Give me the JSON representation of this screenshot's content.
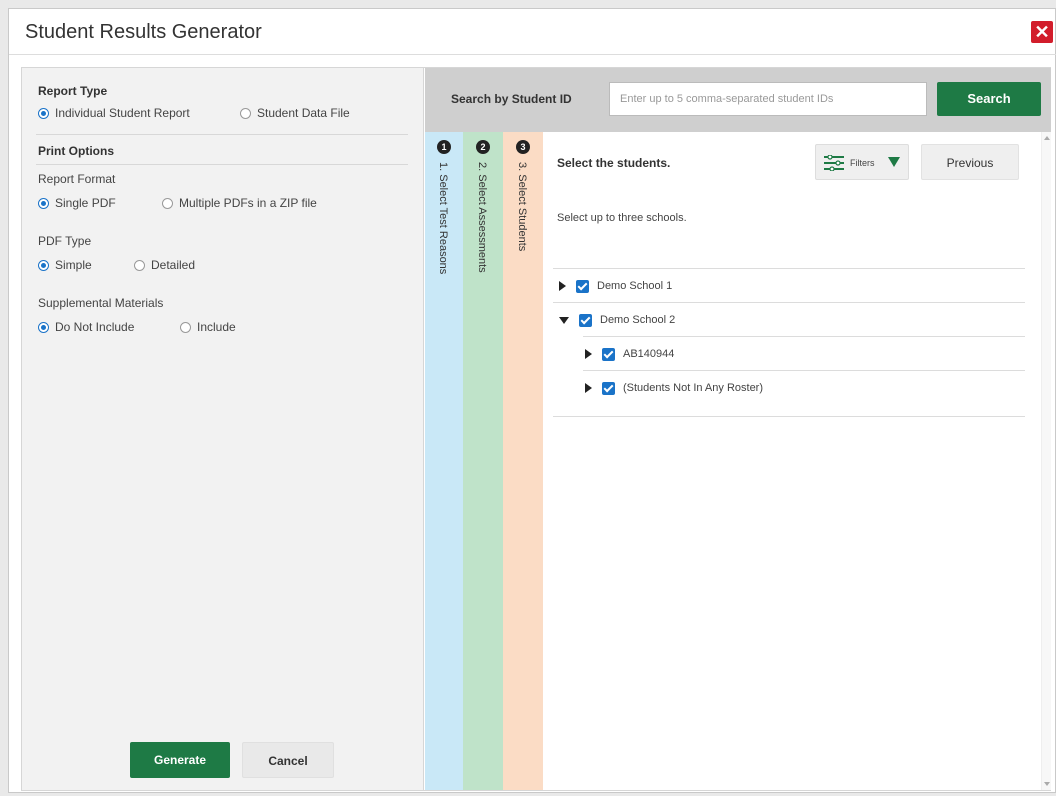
{
  "window": {
    "title": "Student Results Generator",
    "close_glyph": "✕"
  },
  "left": {
    "report_type": {
      "heading": "Report Type",
      "options": [
        "Individual Student Report",
        "Student Data File"
      ],
      "selected": "Individual Student Report"
    },
    "print_options": {
      "heading": "Print Options"
    },
    "report_format": {
      "label": "Report Format",
      "options": [
        "Single PDF",
        "Multiple PDFs in a ZIP file"
      ],
      "selected": "Single PDF"
    },
    "pdf_type": {
      "label": "PDF Type",
      "options": [
        "Simple",
        "Detailed"
      ],
      "selected": "Simple"
    },
    "supplemental": {
      "label": "Supplemental Materials",
      "options": [
        "Do Not Include",
        "Include"
      ],
      "selected": "Do Not Include"
    },
    "generate_label": "Generate",
    "cancel_label": "Cancel"
  },
  "search": {
    "label": "Search by Student ID",
    "placeholder": "Enter up to 5 comma-separated student IDs",
    "button_label": "Search"
  },
  "steps": [
    {
      "number": "1",
      "label": "1. Select Test Reasons",
      "color": "#c9e8f7"
    },
    {
      "number": "2",
      "label": "2. Select Assessments",
      "color": "#bfe3c9"
    },
    {
      "number": "3",
      "label": "3. Select Students",
      "color": "#fbdcc5"
    }
  ],
  "students": {
    "heading": "Select the students.",
    "subheading": "Select up to three schools.",
    "filters_label": "Filters",
    "previous_label": "Previous",
    "tree": [
      {
        "label": "Demo School 1",
        "expanded": false,
        "checked": true,
        "level": 0
      },
      {
        "label": "Demo School 2",
        "expanded": true,
        "checked": true,
        "level": 0
      },
      {
        "label": "AB140944",
        "expanded": false,
        "checked": true,
        "level": 1
      },
      {
        "label": "(Students Not In Any Roster)",
        "expanded": false,
        "checked": true,
        "level": 1
      }
    ]
  },
  "colors": {
    "accent_green": "#1e7a45",
    "radio_blue": "#1a73c8",
    "close_red": "#d21d2b"
  }
}
